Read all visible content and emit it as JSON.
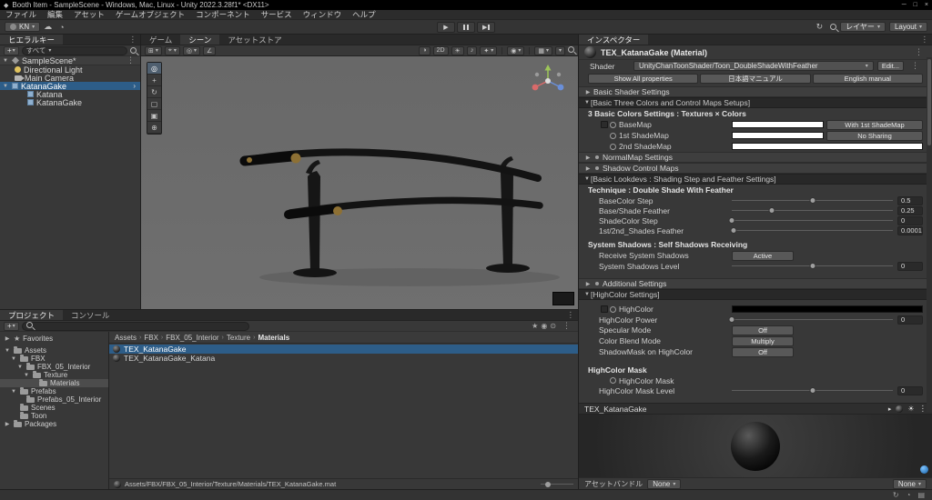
{
  "titlebar": {
    "title": "Booth Item - SampleScene - Windows, Mac, Linux - Unity 2022.3.28f1* <DX11>"
  },
  "menubar": {
    "items": [
      {
        "label": "ファイル"
      },
      {
        "label": "編集"
      },
      {
        "label": "アセット"
      },
      {
        "label": "ゲームオブジェクト"
      },
      {
        "label": "コンポーネント"
      },
      {
        "label": "サービス"
      },
      {
        "label": "ウィンドウ"
      },
      {
        "label": "ヘルプ"
      }
    ]
  },
  "toolbar": {
    "account_label": "KN",
    "layers_label": "レイヤー",
    "layout_label": "Layout"
  },
  "hierarchy": {
    "tab_label": "ヒエラルキー",
    "search_filter": "すべて",
    "scene_name": "SampleScene*",
    "items": [
      {
        "label": "Directional Light"
      },
      {
        "label": "Main Camera"
      },
      {
        "label": "KatanaGake"
      },
      {
        "label": "Katana"
      },
      {
        "label": "KatanaGake"
      }
    ]
  },
  "scene_view": {
    "tab_game": "ゲーム",
    "tab_scene": "シーン",
    "tab_asset_store": "アセットストア",
    "btn_2d": "2D"
  },
  "inspector": {
    "tab_label": "インスペクター",
    "material_title": "TEX_KatanaGake (Material)",
    "shader_label": "Shader",
    "shader_value": "UnityChanToonShader/Toon_DoubleShadeWithFeather",
    "edit_button": "Edit...",
    "btn_show_all": "Show All properties",
    "btn_ja_manual": "日本語マニュアル",
    "btn_en_manual": "English manual",
    "fold_basic": "Basic Shader Settings",
    "sec_three_colors": "[Basic Three Colors and Control Maps Setups]",
    "head_three_colors": "3 Basic Colors Settings : Textures × Colors",
    "basemap": {
      "label": "BaseMap",
      "button": "With 1st ShadeMap",
      "color": "#ffffff"
    },
    "shade1": {
      "label": "1st ShadeMap",
      "button": "No Sharing",
      "color": "#ffffff"
    },
    "shade2": {
      "label": "2nd ShadeMap",
      "color": "#ffffff"
    },
    "fold_normalmap": "NormalMap Settings",
    "fold_shadowmaps": "Shadow Control Maps",
    "sec_lookdevs": "[Basic Lookdevs : Shading Step and Feather Settings]",
    "head_technique": "Technique : Double Shade With Feather",
    "sliders": [
      {
        "label": "BaseColor Step",
        "value": "0.5",
        "pct": 50
      },
      {
        "label": "Base/Shade Feather",
        "value": "0.25",
        "pct": 25
      },
      {
        "label": "ShadeColor Step",
        "value": "0",
        "pct": 0
      },
      {
        "label": "1st/2nd_Shades Feather",
        "value": "0.0001",
        "pct": 1
      }
    ],
    "head_system_shadows": "System Shadows : Self Shadows Receiving",
    "receive_shadows": {
      "label": "Receive System Shadows",
      "button": "Active"
    },
    "shadow_level": {
      "label": "System Shadows Level",
      "value": "0",
      "pct": 50
    },
    "fold_additional": "Additional Settings",
    "sec_highcolor": "[HighColor Settings]",
    "highcolor": {
      "label": "HighColor",
      "color": "#000000"
    },
    "highcolor_power": {
      "label": "HighColor Power",
      "value": "0",
      "pct": 0
    },
    "specular_mode": {
      "label": "Specular Mode",
      "button": "Off"
    },
    "blend_mode": {
      "label": "Color Blend Mode",
      "button": "Multiply"
    },
    "shadowmask": {
      "label": "ShadowMask on HighColor",
      "button": "Off"
    },
    "head_highcolor_mask": "HighColor Mask",
    "highcolor_mask_slot": {
      "label": "HighColor Mask"
    },
    "mask_level": {
      "label": "HighColor Mask Level",
      "value": "0",
      "pct": 50
    },
    "preview_title": "TEX_KatanaGake",
    "assetbundle_label": "アセットバンドル",
    "assetbundle_none": "None",
    "assetbundle_variant": "None"
  },
  "project": {
    "tab_project": "プロジェクト",
    "tab_console": "コンソール",
    "favorites_label": "Favorites",
    "tree": [
      {
        "label": "Assets"
      },
      {
        "label": "FBX"
      },
      {
        "label": "FBX_05_Interior"
      },
      {
        "label": "Texture"
      },
      {
        "label": "Materials"
      },
      {
        "label": "Prefabs"
      },
      {
        "label": "Prefabs_05_Interior"
      },
      {
        "label": "Scenes"
      },
      {
        "label": "Toon"
      },
      {
        "label": "Packages"
      }
    ],
    "breadcrumbs": [
      {
        "label": "Assets"
      },
      {
        "label": "FBX"
      },
      {
        "label": "FBX_05_Interior"
      },
      {
        "label": "Texture"
      },
      {
        "label": "Materials"
      }
    ],
    "files": [
      {
        "label": "TEX_KatanaGake"
      },
      {
        "label": "TEX_KatanaGake_Katana"
      }
    ],
    "status_path": "Assets/FBX/FBX_05_Interior/Texture/Materials/TEX_KatanaGake.mat"
  },
  "colors": {
    "selection_blue": "#2d5d88",
    "scene_background": "#6b6b6b",
    "tsuba_gold": "#8d7034"
  }
}
